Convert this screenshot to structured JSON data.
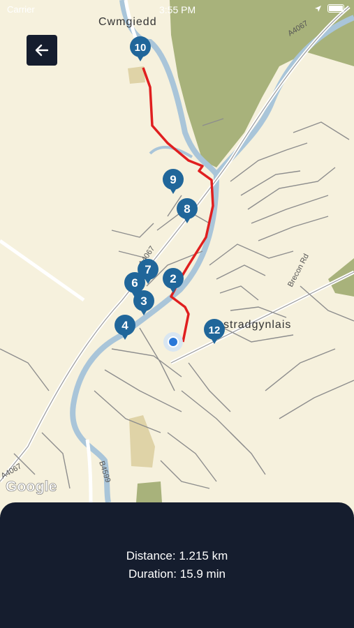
{
  "status_bar": {
    "carrier": "Carrier",
    "time": "3:55 PM"
  },
  "map": {
    "place_labels": {
      "cwmgiedd": "Cwmgiedd",
      "ystradgynlais": "stradgynlais"
    },
    "road_labels": {
      "a4067_top": "A4067",
      "a4067_mid": "A4067",
      "a4067_bottom": "A4067",
      "brecon_rd": "Brecon Rd",
      "b4599": "B4599"
    },
    "markers": [
      "10",
      "9",
      "8",
      "7",
      "6",
      "3",
      "2",
      "4",
      "12"
    ],
    "attribution": "Google",
    "colors": {
      "land": "#f6f1dd",
      "forest": "#a8b27b",
      "river": "#a9c5d9",
      "route": "#e01f1f",
      "marker": "#20669a"
    }
  },
  "panel": {
    "distance": "Distance: 1.215 km",
    "duration": "Duration: 15.9 min"
  }
}
